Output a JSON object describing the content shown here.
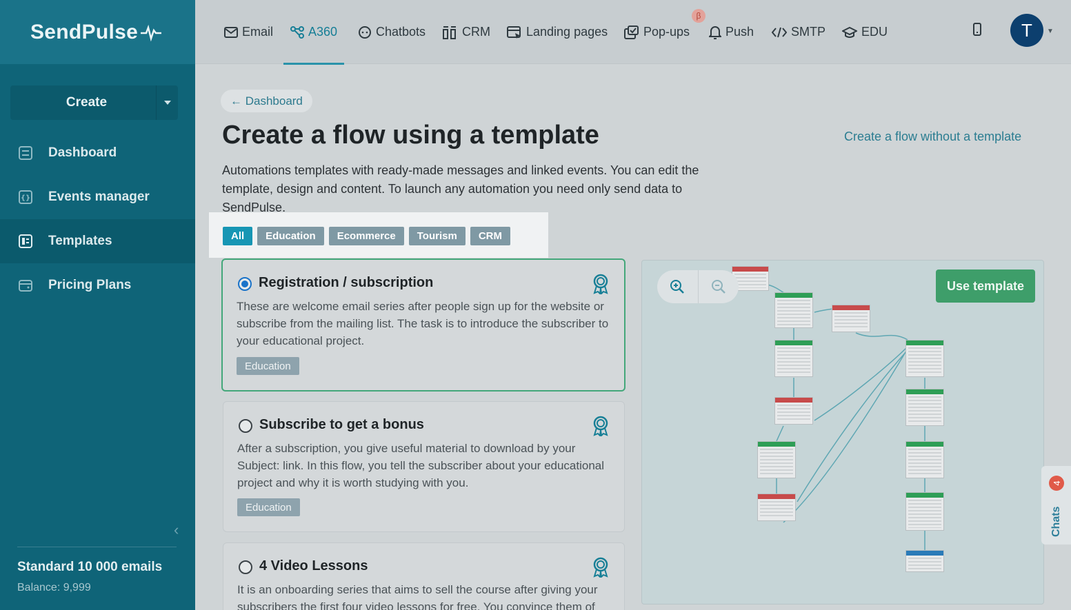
{
  "sidebar": {
    "logo": "SendPulse",
    "create_label": "Create",
    "items": [
      {
        "label": "Dashboard",
        "icon": "dashboard-icon"
      },
      {
        "label": "Events manager",
        "icon": "events-icon"
      },
      {
        "label": "Templates",
        "icon": "templates-icon",
        "active": true
      },
      {
        "label": "Pricing Plans",
        "icon": "wallet-icon"
      }
    ],
    "plan": "Standard 10 000 emails",
    "balance": "Balance: 9,999"
  },
  "topnav": {
    "items": [
      "Email",
      "A360",
      "Chatbots",
      "CRM",
      "Landing pages",
      "Pop-ups",
      "Push",
      "SMTP",
      "EDU"
    ],
    "active": "A360",
    "beta": "β",
    "avatar": "T"
  },
  "main": {
    "back": "← Dashboard",
    "title": "Create a flow using a template",
    "alt_link": "Create a flow without a template",
    "description": "Automations templates with ready-made messages and linked events. You can edit the template, design and content. To launch any automation you need only send data to SendPulse.",
    "filters": [
      "All",
      "Education",
      "Ecommerce",
      "Tourism",
      "CRM"
    ],
    "active_filter": "All",
    "cards": [
      {
        "title": "Registration / subscription",
        "description": "These are welcome email series after people sign up for the website or subscribe from the mailing list. The task is to introduce the subscriber to your educational project.",
        "tag": "Education",
        "selected": true
      },
      {
        "title": "Subscribe to get a bonus",
        "description": "After a subscription, you give useful material to download by your Subject: link. In this flow, you tell the subscriber about your educational project and why it is worth studying with you.",
        "tag": "Education",
        "selected": false
      },
      {
        "title": "4 Video Lessons",
        "description": "It is an onboarding series that aims to sell the course after giving your subscribers the first four video lessons for free. You convince them of",
        "tag": "",
        "selected": false
      }
    ]
  },
  "preview": {
    "use_template": "Use template"
  },
  "chats": {
    "label": "Chats",
    "count": "4"
  },
  "colors": {
    "sidebar": "#0f6478",
    "accent": "#1796b4",
    "success": "#3e9e6a"
  }
}
